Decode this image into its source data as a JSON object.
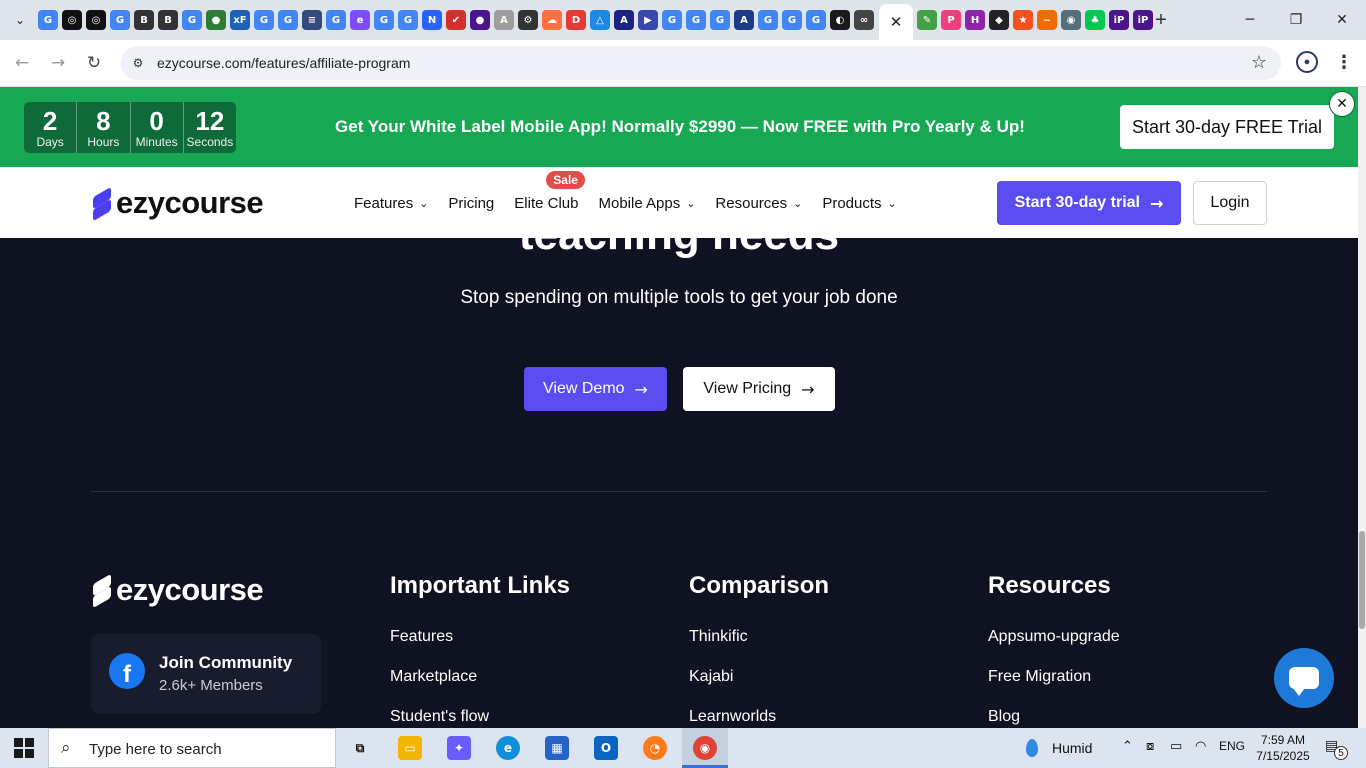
{
  "browser": {
    "tabs_left": [
      {
        "icon": "google-icon",
        "glyph": "G",
        "color": "#4285f4"
      },
      {
        "icon": "openai-icon",
        "glyph": "◎",
        "color": "#111111"
      },
      {
        "icon": "openai-icon",
        "glyph": "◎",
        "color": "#111111"
      },
      {
        "icon": "google-icon",
        "glyph": "G",
        "color": "#4285f4"
      },
      {
        "icon": "b-icon",
        "glyph": "B",
        "color": "#333333"
      },
      {
        "icon": "b-icon",
        "glyph": "B",
        "color": "#333333"
      },
      {
        "icon": "google-icon",
        "glyph": "G",
        "color": "#4285f4"
      },
      {
        "icon": "globe-icon",
        "glyph": "●",
        "color": "#2e7d32"
      },
      {
        "icon": "xf-icon",
        "glyph": "xF",
        "color": "#1b62b6"
      },
      {
        "icon": "google-icon",
        "glyph": "G",
        "color": "#4285f4"
      },
      {
        "icon": "google-icon",
        "glyph": "G",
        "color": "#4285f4"
      },
      {
        "icon": "stack-icon",
        "glyph": "≡",
        "color": "#344a7a"
      },
      {
        "icon": "google-icon",
        "glyph": "G",
        "color": "#4285f4"
      },
      {
        "icon": "e-icon",
        "glyph": "e",
        "color": "#7c4dff"
      },
      {
        "icon": "google-icon",
        "glyph": "G",
        "color": "#4285f4"
      },
      {
        "icon": "google-icon",
        "glyph": "G",
        "color": "#4285f4"
      },
      {
        "icon": "n-icon",
        "glyph": "N",
        "color": "#2962ff"
      },
      {
        "icon": "check-icon",
        "glyph": "✔",
        "color": "#d32f2f"
      },
      {
        "icon": "circle-icon",
        "glyph": "●",
        "color": "#4a148c"
      },
      {
        "icon": "adk-icon",
        "glyph": "A",
        "color": "#9e9e9e"
      },
      {
        "icon": "gear-icon",
        "glyph": "⚙",
        "color": "#333333"
      },
      {
        "icon": "cloud-icon",
        "glyph": "☁",
        "color": "#ff7043"
      },
      {
        "icon": "d-icon",
        "glyph": "D",
        "color": "#e53935"
      },
      {
        "icon": "triangle-icon",
        "glyph": "△",
        "color": "#1e88e5"
      },
      {
        "icon": "a-icon",
        "glyph": "A",
        "color": "#1a237e"
      },
      {
        "icon": "play-icon",
        "glyph": "▶",
        "color": "#3949ab"
      },
      {
        "icon": "google-icon",
        "glyph": "G",
        "color": "#4285f4"
      },
      {
        "icon": "google-icon",
        "glyph": "G",
        "color": "#4285f4"
      },
      {
        "icon": "google-icon",
        "glyph": "G",
        "color": "#4285f4"
      },
      {
        "icon": "signature-icon",
        "glyph": "A",
        "color": "#1e3a8a"
      },
      {
        "icon": "google-icon",
        "glyph": "G",
        "color": "#4285f4"
      },
      {
        "icon": "google-icon",
        "glyph": "G",
        "color": "#4285f4"
      },
      {
        "icon": "google-icon",
        "glyph": "G",
        "color": "#4285f4"
      },
      {
        "icon": "ellipse-icon",
        "glyph": "◐",
        "color": "#1a1a1a"
      },
      {
        "icon": "link-icon",
        "glyph": "∞",
        "color": "#444444"
      }
    ],
    "tabs_right": [
      {
        "icon": "leaf-icon",
        "glyph": "✎",
        "color": "#43a047"
      },
      {
        "icon": "p-icon",
        "glyph": "P",
        "color": "#ec407a"
      },
      {
        "icon": "h-icon",
        "glyph": "H",
        "color": "#8e24aa"
      },
      {
        "icon": "shield-icon",
        "glyph": "◆",
        "color": "#222222"
      },
      {
        "icon": "badge-icon",
        "glyph": "★",
        "color": "#f4511e"
      },
      {
        "icon": "wave-icon",
        "glyph": "~",
        "color": "#ef6c00"
      },
      {
        "icon": "globe-icon",
        "glyph": "◉",
        "color": "#546e7a"
      },
      {
        "icon": "tree-icon",
        "glyph": "♣",
        "color": "#00c853"
      },
      {
        "icon": "ip-icon",
        "glyph": "iP",
        "color": "#4a148c"
      },
      {
        "icon": "ip-icon",
        "glyph": "iP",
        "color": "#4a148c"
      }
    ],
    "active_tab_close": "✕",
    "new_tab": "+",
    "url": "ezycourse.com/features/affiliate-program"
  },
  "promo": {
    "countdown": [
      {
        "value": "2",
        "label": "Days"
      },
      {
        "value": "8",
        "label": "Hours"
      },
      {
        "value": "0",
        "label": "Minutes"
      },
      {
        "value": "12",
        "label": "Seconds"
      }
    ],
    "message": "Get Your White Label Mobile App! Normally $2990 — Now FREE with Pro Yearly & Up!",
    "cta": "Start 30-day FREE Trial",
    "close": "✕"
  },
  "nav": {
    "logo": "ezycourse",
    "items": {
      "features": "Features",
      "pricing": "Pricing",
      "elite_club": "Elite Club",
      "sale_badge": "Sale",
      "mobile_apps": "Mobile Apps",
      "resources": "Resources",
      "products": "Products"
    },
    "trial": "Start 30-day trial",
    "login": "Login"
  },
  "hero": {
    "heading_partial": "teaching needs",
    "subheading": "Stop spending on multiple tools to get your job done",
    "demo": "View Demo",
    "pricing": "View Pricing"
  },
  "footer": {
    "logo": "ezycourse",
    "community_title": "Join Community",
    "community_sub": "2.6k+ Members",
    "important_links": {
      "title": "Important Links",
      "links": [
        "Features",
        "Marketplace",
        "Student's flow"
      ]
    },
    "comparison": {
      "title": "Comparison",
      "links": [
        "Thinkific",
        "Kajabi",
        "Learnworlds"
      ]
    },
    "resources": {
      "title": "Resources",
      "links": [
        "Appsumo-upgrade",
        "Free Migration",
        "Blog"
      ]
    }
  },
  "taskbar": {
    "search_placeholder": "Type here to search",
    "weather": "Humid",
    "language": "ENG",
    "time": "7:59 AM",
    "date": "7/15/2025",
    "notifications": "5"
  },
  "colors": {
    "promo_green": "#18a854",
    "brand_purple": "#5b4cf0",
    "dark_bg": "#0f1220"
  }
}
